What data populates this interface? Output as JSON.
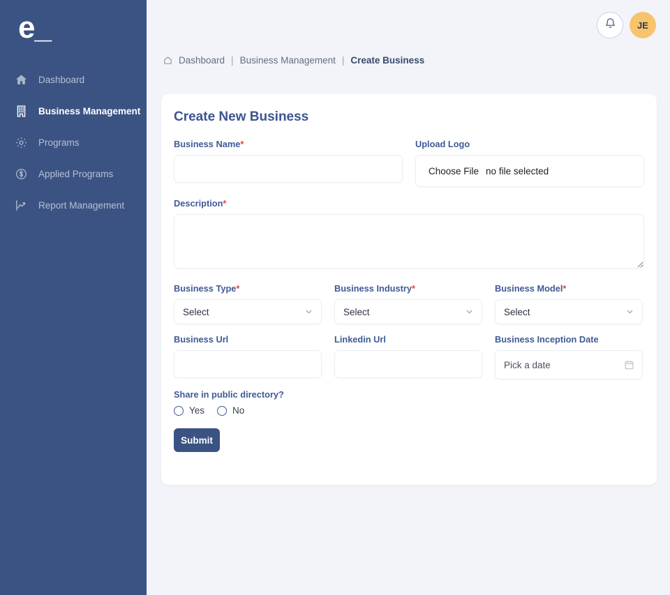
{
  "brand": {
    "logo_text": "e_",
    "sidebar_color": "#3a5382",
    "accent_color": "#3f5a96",
    "required_color": "#e8443a",
    "avatar_color": "#f7c46c"
  },
  "sidebar": {
    "items": [
      {
        "label": "Dashboard",
        "icon": "home-icon",
        "active": false
      },
      {
        "label": "Business Management",
        "icon": "building-icon",
        "active": true
      },
      {
        "label": "Programs",
        "icon": "gear-icon",
        "active": false
      },
      {
        "label": "Applied Programs",
        "icon": "dollar-circle-icon",
        "active": false
      },
      {
        "label": "Report Management",
        "icon": "chart-line-icon",
        "active": false
      }
    ]
  },
  "topbar": {
    "notification_icon": "bell-icon",
    "avatar_initials": "JE"
  },
  "breadcrumb": {
    "home_icon": "home-icon",
    "items": [
      "Dashboard",
      "Business Management",
      "Create Business"
    ],
    "separator": "|"
  },
  "form": {
    "title": "Create New Business",
    "business_name": {
      "label": "Business Name",
      "required": true,
      "value": "",
      "placeholder": ""
    },
    "upload_logo": {
      "label": "Upload Logo",
      "required": false,
      "button_label": "Choose File",
      "status": "no file selected"
    },
    "description": {
      "label": "Description",
      "required": true,
      "value": "",
      "placeholder": ""
    },
    "business_type": {
      "label": "Business Type",
      "required": true,
      "value": "Select",
      "caret_icon": "chevron-down-icon"
    },
    "business_industry": {
      "label": "Business Industry",
      "required": true,
      "value": "Select",
      "caret_icon": "chevron-down-icon"
    },
    "business_model": {
      "label": "Business Model",
      "required": true,
      "value": "Select",
      "caret_icon": "chevron-down-icon"
    },
    "business_url": {
      "label": "Business Url",
      "required": false,
      "value": "",
      "placeholder": ""
    },
    "linkedin_url": {
      "label": "Linkedin Url",
      "required": false,
      "value": "",
      "placeholder": ""
    },
    "inception_date": {
      "label": "Business Inception Date",
      "required": false,
      "placeholder": "Pick a date",
      "icon": "calendar-icon"
    },
    "share_public": {
      "label": "Share in public directory?",
      "options": [
        {
          "label": "Yes",
          "selected": false
        },
        {
          "label": "No",
          "selected": false
        }
      ]
    },
    "submit_label": "Submit"
  }
}
